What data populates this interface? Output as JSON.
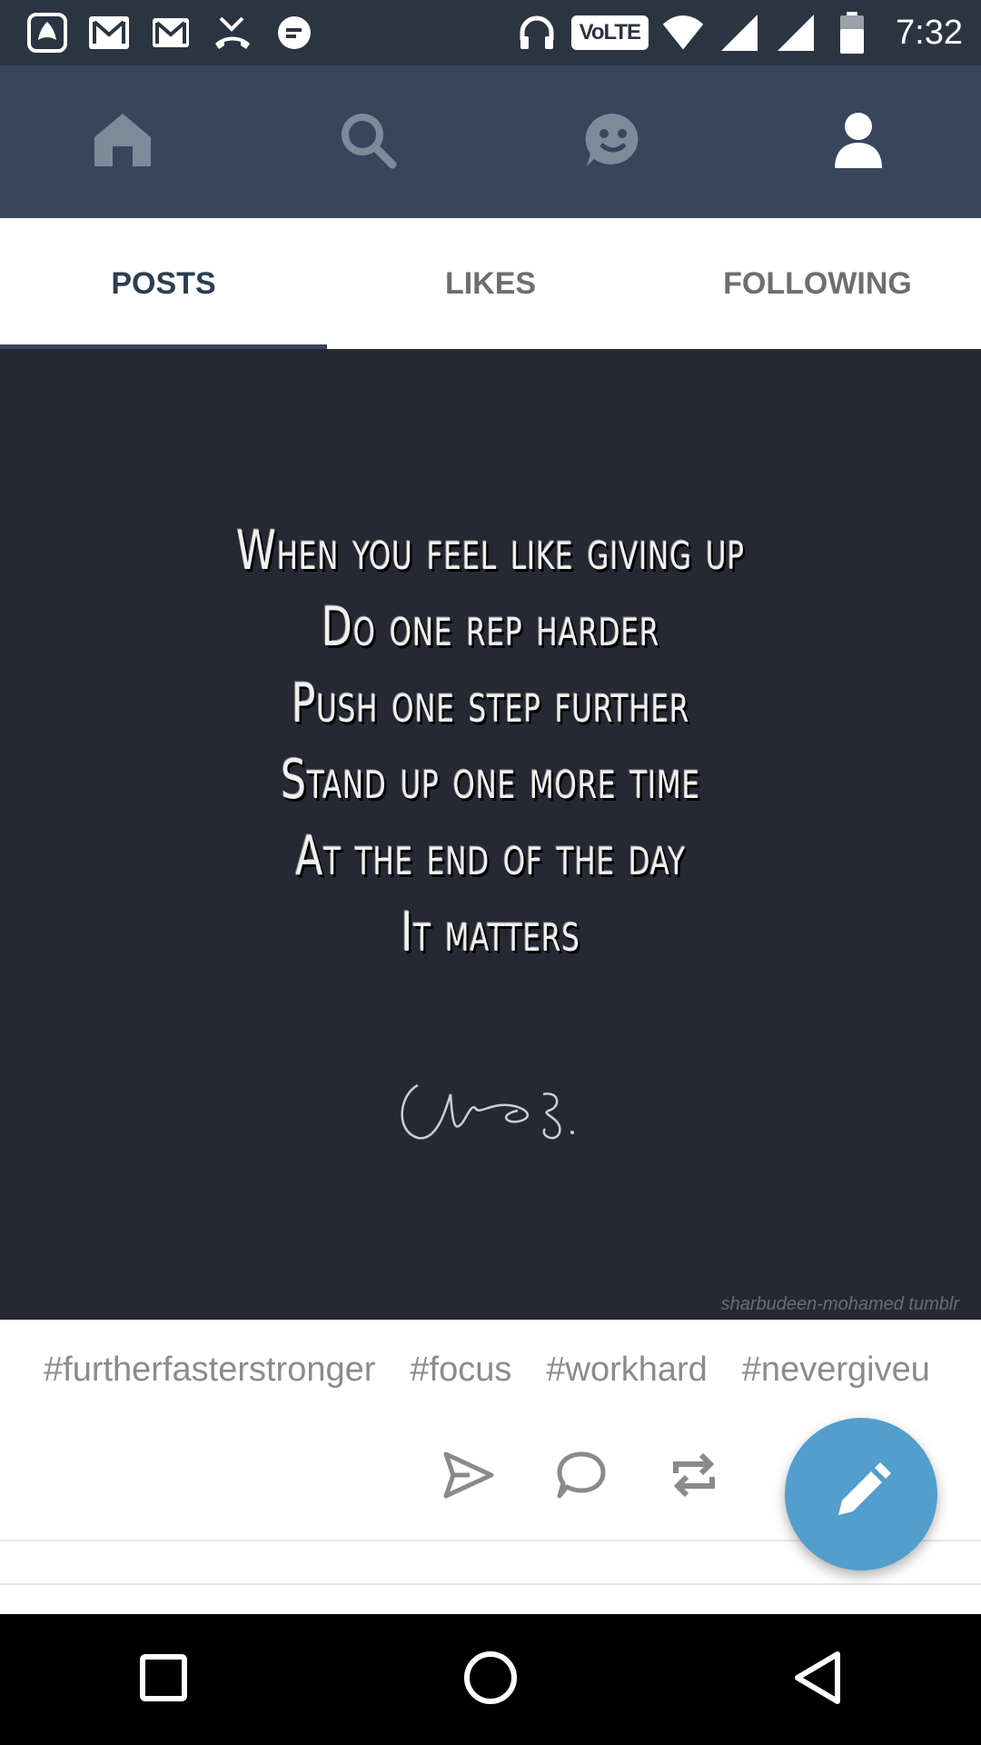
{
  "status_bar": {
    "left_icons": [
      "saavn-icon",
      "gmail-icon",
      "gmail-icon",
      "missed-call-icon",
      "messenger-icon"
    ],
    "volte": "VoLTE",
    "time": "7:32",
    "right_icons": [
      "headphones-icon",
      "wifi-icon",
      "signal-icon",
      "signal-icon",
      "battery-icon"
    ]
  },
  "app_nav": {
    "items": [
      {
        "icon": "home-icon",
        "active": false
      },
      {
        "icon": "search-icon",
        "active": false
      },
      {
        "icon": "smiley-icon",
        "active": false
      },
      {
        "icon": "account-icon",
        "active": true
      }
    ]
  },
  "tabs": [
    {
      "label": "POSTS",
      "active": true
    },
    {
      "label": "LIKES",
      "active": false
    },
    {
      "label": "FOLLOWING",
      "active": false
    }
  ],
  "post": {
    "quote_lines": [
      "When you feel like giving up",
      "Do one rep harder",
      "Push one step further",
      "Stand up one more time",
      "At the end of the day",
      "It matters"
    ],
    "watermark": "sharbudeen-mohamed tumblr",
    "tags": [
      "#furtherfasterstronger",
      "#focus",
      "#workhard",
      "#nevergiveu"
    ],
    "actions": [
      "share-icon",
      "comment-icon",
      "reblog-icon"
    ]
  },
  "colors": {
    "status_bar": "#2b3441",
    "app_nav": "#36465d",
    "post_bg": "#262833",
    "fab": "#529ecc"
  }
}
